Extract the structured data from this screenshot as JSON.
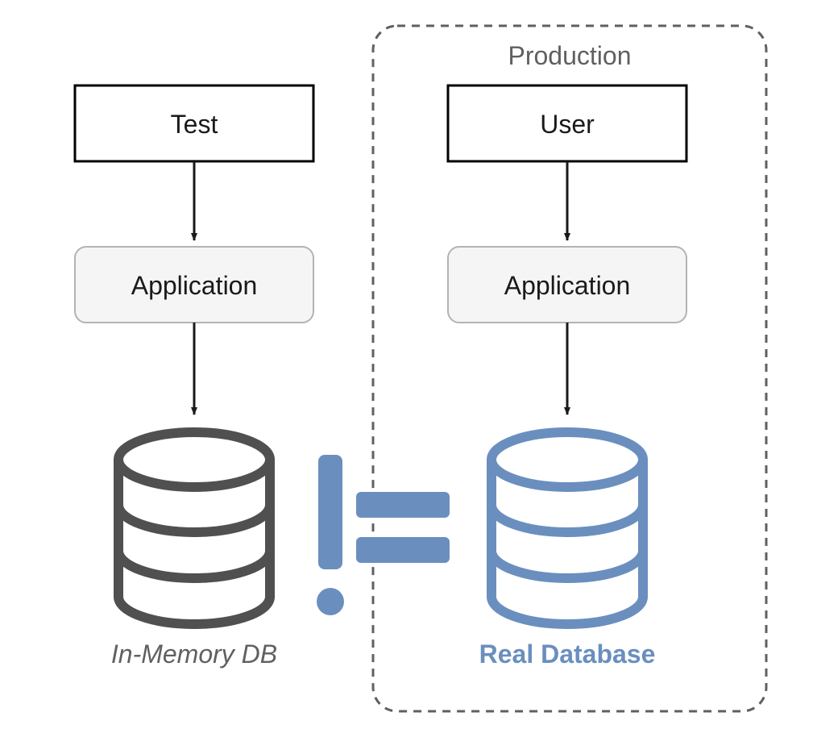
{
  "production_label": "Production",
  "left": {
    "top_box": "Test",
    "app_box": "Application",
    "db_label": "In-Memory DB"
  },
  "right": {
    "top_box": "User",
    "app_box": "Application",
    "db_label": "Real Database"
  },
  "colors": {
    "dark_stroke": "#505050",
    "box_border": "#000000",
    "app_fill": "#f5f5f5",
    "app_border": "#b3b3b3",
    "blue": "#6a8fbf",
    "text_dark": "#333333",
    "text_gray": "#606060"
  }
}
